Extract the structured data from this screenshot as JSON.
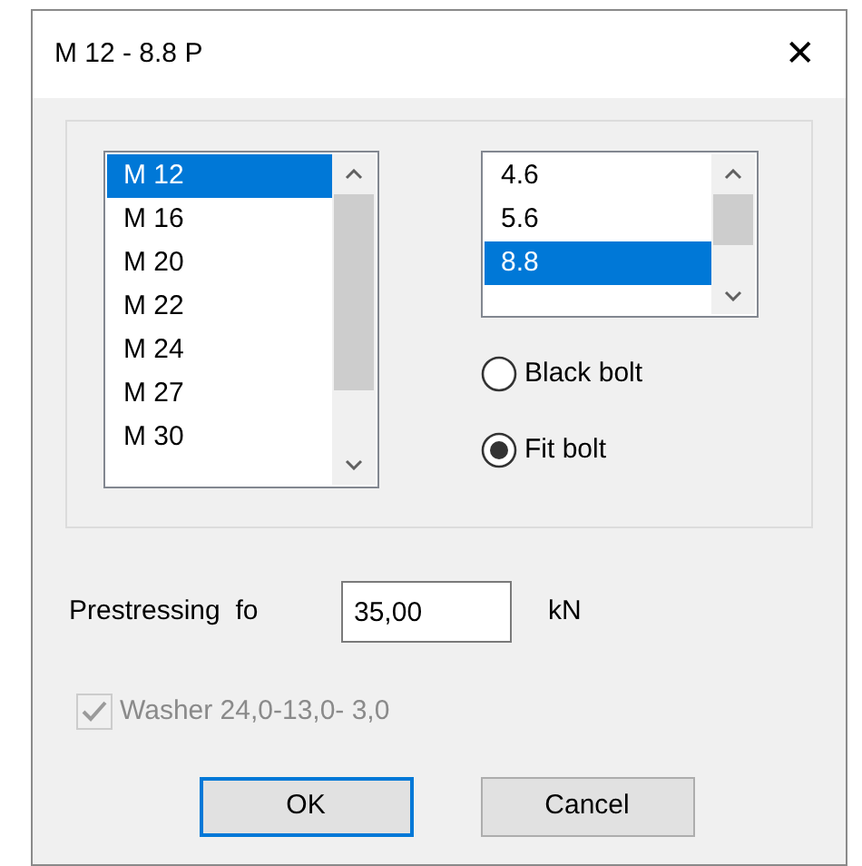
{
  "window": {
    "title": "M 12 - 8.8 P",
    "close": "✕"
  },
  "size_list": {
    "items": [
      {
        "label": "M 12",
        "selected": true
      },
      {
        "label": "M 16",
        "selected": false
      },
      {
        "label": "M 20",
        "selected": false
      },
      {
        "label": "M 22",
        "selected": false
      },
      {
        "label": "M 24",
        "selected": false
      },
      {
        "label": "M 27",
        "selected": false
      },
      {
        "label": "M 30",
        "selected": false
      }
    ]
  },
  "grade_list": {
    "items": [
      {
        "label": "4.6",
        "selected": false
      },
      {
        "label": "5.6",
        "selected": false
      },
      {
        "label": "8.8",
        "selected": true
      }
    ]
  },
  "bolt_type": [
    {
      "label": "Black bolt",
      "selected": false
    },
    {
      "label": "Fit bolt",
      "selected": true
    }
  ],
  "prestressing": {
    "label": "Prestressing  fo",
    "value": "35,00",
    "unit": "kN"
  },
  "washer": {
    "label": "Washer 24,0-13,0- 3,0",
    "checked": true,
    "disabled": true
  },
  "buttons": [
    {
      "label": "OK",
      "default": true
    },
    {
      "label": "Cancel",
      "default": false
    }
  ]
}
